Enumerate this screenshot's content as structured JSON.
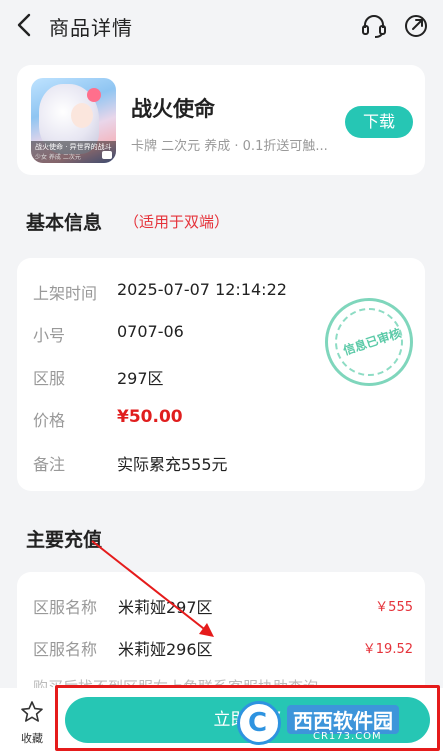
{
  "header": {
    "title": "商品详情",
    "back_icon": "back-arrow-icon",
    "support_icon": "headset-icon",
    "share_icon": "share-icon"
  },
  "game": {
    "name": "战火使命",
    "tags": "卡牌 二次元 养成 · 0.1折送可触...",
    "download_label": "下载",
    "cover_line1": "战火使命 · 异世界的战斗",
    "cover_line2": "少女  养成  二次元"
  },
  "basic_info": {
    "title": "基本信息",
    "note": "（适用于双端）",
    "rows": [
      {
        "key": "上架时间",
        "value": "2025-07-07 12:14:22"
      },
      {
        "key": "小号",
        "value": "0707-06"
      },
      {
        "key": "区服",
        "value": "297区"
      },
      {
        "key": "价格",
        "value": "¥50.00"
      },
      {
        "key": "备注",
        "value": "实际累充555元"
      }
    ],
    "stamp_text": "信息已审核"
  },
  "recharge": {
    "title": "主要充值",
    "rows": [
      {
        "key": "区服名称",
        "value": "米莉娅297区",
        "amount": "￥555"
      },
      {
        "key": "区服名称",
        "value": "米莉娅296区",
        "amount": "￥19.52"
      }
    ],
    "hint": "购买后找不到区服右上角联系客服协助查询"
  },
  "bottom": {
    "favorite_label": "收藏",
    "buy_label": "立即购买"
  },
  "watermark": {
    "text": "西西软件园",
    "sub": "CR173.COM"
  },
  "colors": {
    "accent": "#26c6b4",
    "price": "#e01e1e",
    "highlight": "#e51b1b"
  }
}
